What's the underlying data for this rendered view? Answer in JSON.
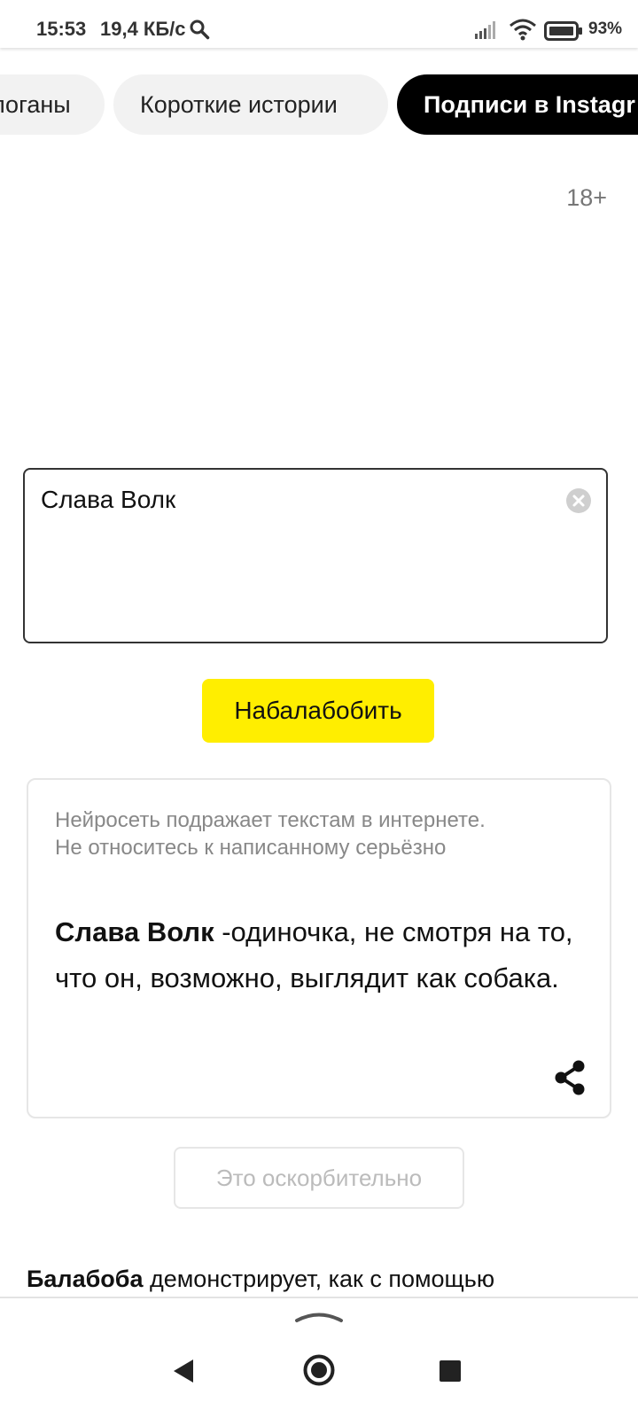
{
  "status_bar": {
    "time": "15:53",
    "speed": "19,4 КБ/с",
    "battery": "93%"
  },
  "categories": {
    "items": [
      {
        "label": "логаны",
        "active": false
      },
      {
        "label": "Короткие истории",
        "active": false
      },
      {
        "label": "Подписи в Instagr",
        "active": true
      }
    ]
  },
  "age_rating": "18+",
  "input": {
    "value": "Слава Волк"
  },
  "generate_button": "Набалабобить",
  "result": {
    "disclaimer_line1": "Нейросеть подражает текстам в интернете.",
    "disclaimer_line2": "Не относитесь к написанному серьёзно",
    "bold": "Слава Волк",
    "text": " -одиночка, не смотря на то, что он, возможно, выглядит как собака."
  },
  "offensive_button": "Это оскорбительно",
  "about": {
    "bold": "Балабоба",
    "text": " демонстрирует, как с помощью"
  },
  "colors": {
    "accent": "#ffee00",
    "active_chip": "#000000",
    "chip": "#f2f2f2"
  }
}
